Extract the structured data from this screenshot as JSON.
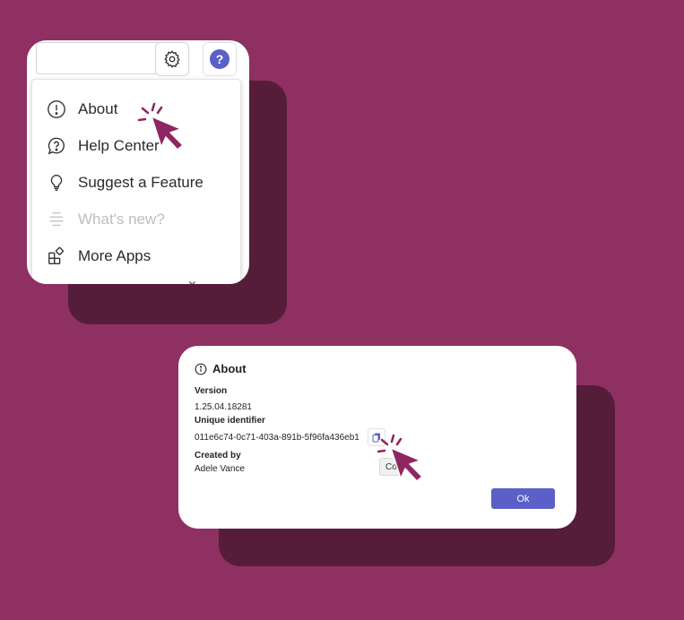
{
  "menu": {
    "items": [
      {
        "label": "About",
        "icon": "info-circle-icon",
        "disabled": false
      },
      {
        "label": "Help Center",
        "icon": "help-chat-icon",
        "disabled": false
      },
      {
        "label": "Suggest a Feature",
        "icon": "lightbulb-icon",
        "disabled": false
      },
      {
        "label": "What's new?",
        "icon": "whats-new-icon",
        "disabled": true
      },
      {
        "label": "More Apps",
        "icon": "apps-icon",
        "disabled": false
      }
    ],
    "cut_off_text": "...  ✕"
  },
  "dialog": {
    "title": "About",
    "version_label": "Version",
    "version_value": "1.25.04.18281",
    "uid_label": "Unique identifier",
    "uid_value": "011e6c74-0c71-403a-891b-5f96fa436eb1",
    "created_label": "Created by",
    "created_value": "Adele Vance",
    "copy_tooltip": "Co",
    "ok_label": "Ok"
  },
  "colors": {
    "background": "#8f3063",
    "shadow": "#561d3b",
    "accent": "#5b5fc7",
    "cursor": "#8f2660"
  }
}
